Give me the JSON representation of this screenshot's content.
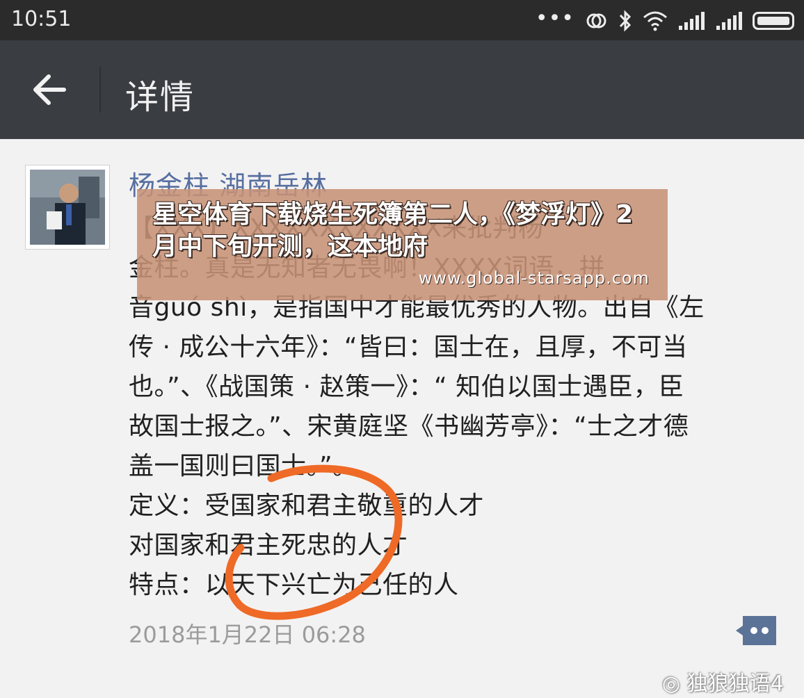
{
  "status_bar": {
    "time": "10:51",
    "icons": [
      "more-dots-icon",
      "sync-icon",
      "bluetooth-icon",
      "wifi-icon",
      "signal-icon",
      "signal-icon",
      "battery-icon"
    ]
  },
  "app_bar": {
    "title": "详情",
    "back_icon": "back-arrow-icon"
  },
  "post": {
    "author": "杨金柱 湖南岳林",
    "lines": [
      "【ⅩⅩⅩ】ⅩⅩⅩⅩⅩⅩⅩⅩⅩⅩⅩⅩ来批判杨",
      "金柱。真是无知者无畏啊！ⅩⅩⅩⅩ词语，拼",
      "音guó shì，是指国中才能最优秀的人物。出自《左",
      "传 · 成公十六年》：“皆曰：国士在，且厚，不可当",
      "也。”、《战国策 · 赵策一》：“ 知伯以国士遇臣，臣",
      "故国士报之。”、宋黄庭坚《书幽芳亭》：“士之才德",
      "盖一国则曰国士。”。",
      "定义：受国家和君主敬重的人才",
      "对国家和君主死忠的人才",
      "特点：以天下兴亡为己任的人"
    ],
    "timestamp": "2018年1月22日 06:28",
    "comment_icon": "comment-bubble-icon"
  },
  "ad_overlay": {
    "text": "星空体育下载烧生死簿第二人，《梦浮灯》2月中下旬开测，这本地府",
    "url": "www.global-starsapp.com"
  },
  "watermark": {
    "text": "独狼独语4",
    "icon": "weibo-logo-icon"
  },
  "colors": {
    "status_bar": "#2b2b2b",
    "app_bar": "#3a3d42",
    "background": "#f3f2f2",
    "author": "#566fa0",
    "circle_mark": "#ee6a26",
    "ad_overlay": "#c79276"
  }
}
